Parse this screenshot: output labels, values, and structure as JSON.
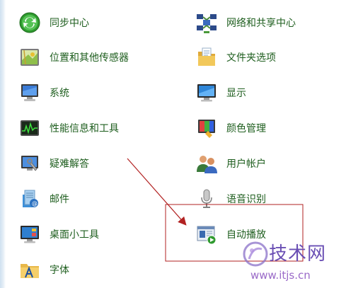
{
  "control_panel": {
    "left_column": [
      {
        "label": "同步中心",
        "icon": "sync-center-icon"
      },
      {
        "label": "位置和其他传感器",
        "icon": "location-sensors-icon"
      },
      {
        "label": "系统",
        "icon": "system-icon"
      },
      {
        "label": "性能信息和工具",
        "icon": "performance-icon"
      },
      {
        "label": "疑难解答",
        "icon": "troubleshooting-icon"
      },
      {
        "label": "邮件",
        "icon": "mail-icon"
      },
      {
        "label": "桌面小工具",
        "icon": "desktop-gadgets-icon"
      },
      {
        "label": "字体",
        "icon": "fonts-icon"
      }
    ],
    "right_column": [
      {
        "label": "网络和共享中心",
        "icon": "network-sharing-icon"
      },
      {
        "label": "文件夹选项",
        "icon": "folder-options-icon"
      },
      {
        "label": "显示",
        "icon": "display-icon"
      },
      {
        "label": "颜色管理",
        "icon": "color-management-icon"
      },
      {
        "label": "用户帐户",
        "icon": "user-accounts-icon"
      },
      {
        "label": "语音识别",
        "icon": "speech-recognition-icon"
      },
      {
        "label": "自动播放",
        "icon": "autoplay-icon"
      }
    ]
  },
  "colors": {
    "label_text": "#1e5e1e",
    "annotation": "#b22222",
    "background": "#ffffff"
  },
  "watermark": {
    "name": "技术网",
    "url": "www.itjs.cn"
  }
}
